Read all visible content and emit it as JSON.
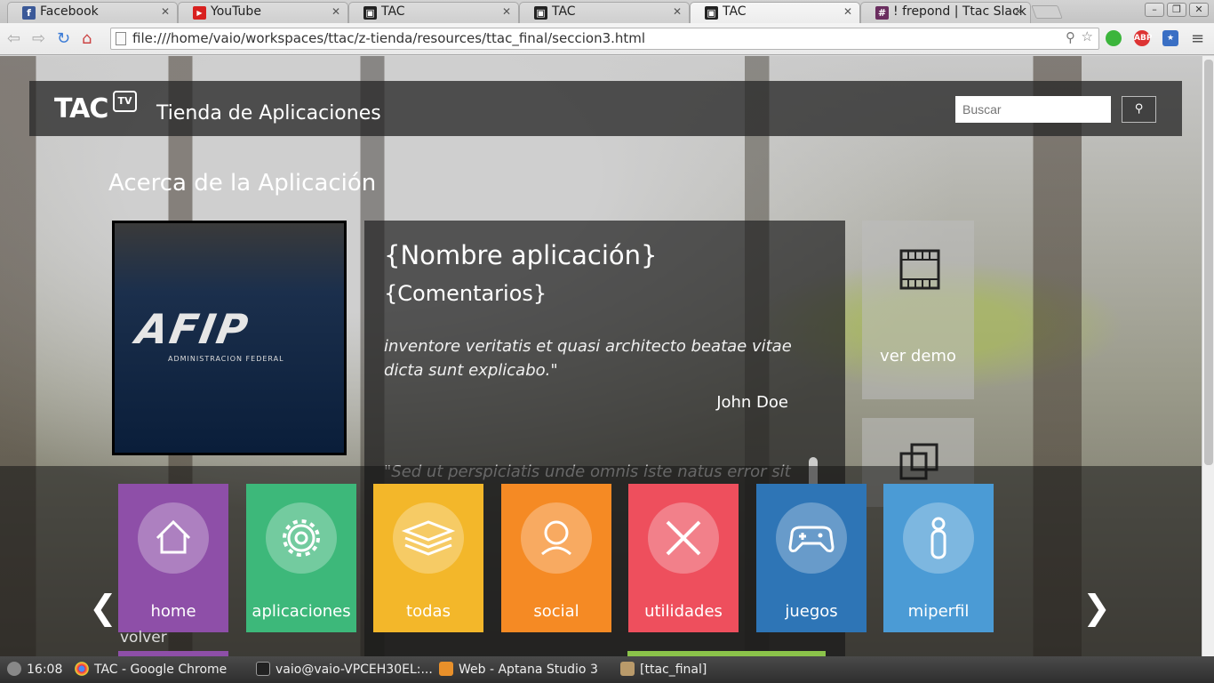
{
  "browser": {
    "tabs": [
      {
        "title": "Facebook",
        "favicon": "facebook-icon",
        "color": "#3b5998",
        "glyph": "f"
      },
      {
        "title": "YouTube",
        "favicon": "youtube-icon",
        "color": "#d8201f",
        "glyph": "▶"
      },
      {
        "title": "TAC",
        "favicon": "tac-icon",
        "color": "#222222",
        "glyph": "▣"
      },
      {
        "title": "TAC",
        "favicon": "tac-icon",
        "color": "#222222",
        "glyph": "▣"
      },
      {
        "title": "TAC",
        "favicon": "tac-icon",
        "color": "#222222",
        "glyph": "▣"
      },
      {
        "title": "! frepond | Ttac Slack",
        "favicon": "slack-icon",
        "color": "#6a2d5f",
        "glyph": "#"
      }
    ],
    "active_tab": 4,
    "url": "file:///home/vaio/workspaces/ttac/z-tienda/resources/ttac_final/seccion3.html",
    "extensions": {
      "abp": "ABP"
    }
  },
  "site": {
    "logo": "TAC",
    "logo_badge": "TV",
    "title": "Tienda de Aplicaciones",
    "search_placeholder": "Buscar"
  },
  "section": {
    "title": "Acerca de la Aplicación",
    "app_logo_text": "AFIP",
    "app_logo_sub": "ADMINISTRACION FEDERAL",
    "app_name": "{Nombre aplicación}",
    "comments_title": "{Comentarios}",
    "quote1": "inventore veritatis et quasi architecto beatae vitae dicta sunt explicabo.\"",
    "author1": "John Doe",
    "quote2": "\"Sed ut perspiciatis unde omnis iste natus error sit",
    "side_tiles": [
      {
        "label": "ver demo",
        "icon": "film-icon"
      }
    ]
  },
  "categories": [
    {
      "label": "home",
      "icon": "home-icon",
      "color": "#8e4fa8"
    },
    {
      "label": "aplicaciones",
      "icon": "gear-icon",
      "color": "#3db87a"
    },
    {
      "label": "todas",
      "icon": "layers-icon",
      "color": "#f3b72a"
    },
    {
      "label": "social",
      "icon": "user-icon",
      "color": "#f58a24"
    },
    {
      "label": "utilidades",
      "icon": "tools-icon",
      "color": "#ee4f5d"
    },
    {
      "label": "juegos",
      "icon": "gamepad-icon",
      "color": "#2e75b6"
    },
    {
      "label": "miperfil",
      "icon": "person-icon",
      "color": "#4b9bd5"
    }
  ],
  "volver_label": "volver",
  "taskbar": {
    "clock": "16:08",
    "tasks": [
      {
        "label": "TAC - Google Chrome",
        "icon": "chrome-icon"
      },
      {
        "label": "vaio@vaio-VPCEH30EL:...",
        "icon": "terminal-icon"
      },
      {
        "label": "Web - Aptana Studio 3",
        "icon": "aptana-icon"
      },
      {
        "label": "[ttac_final]",
        "icon": "folder-icon"
      }
    ]
  }
}
